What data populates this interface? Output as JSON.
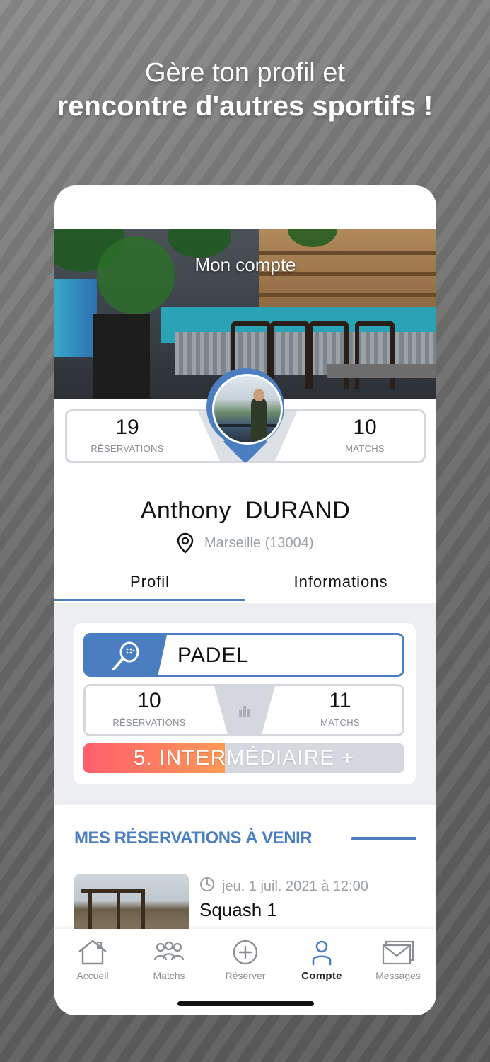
{
  "promo": {
    "line1": "Gère ton profil et",
    "line2": "rencontre d'autres sportifs !"
  },
  "header": {
    "title": "Mon compte"
  },
  "stats": {
    "reservations_count": "19",
    "reservations_label": "RÉSERVATIONS",
    "matches_count": "10",
    "matches_label": "MATCHS"
  },
  "profile": {
    "first_name": "Anthony",
    "last_name": "DURAND",
    "location": "Marseille (13004)"
  },
  "tabs": [
    {
      "label": "Profil",
      "active": true
    },
    {
      "label": "Informations",
      "active": false
    }
  ],
  "sport": {
    "name": "PADEL",
    "icon": "padel-racket-icon",
    "reservations_count": "10",
    "reservations_label": "RÉSERVATIONS",
    "matches_count": "11",
    "matches_label": "MATCHS",
    "level_label": "5. INTERMÉDIAIRE +",
    "level_progress": 0.44
  },
  "upcoming": {
    "title": "MES RÉSERVATIONS À VENIR",
    "items": [
      {
        "date": "jeu. 1 juil. 2021 à 12:00",
        "name": "Squash 1"
      }
    ]
  },
  "nav": [
    {
      "label": "Accueil",
      "icon": "home-icon",
      "active": false
    },
    {
      "label": "Matchs",
      "icon": "players-icon",
      "active": false
    },
    {
      "label": "Réserver",
      "icon": "plus-circle-icon",
      "active": false
    },
    {
      "label": "Compte",
      "icon": "user-icon",
      "active": true
    },
    {
      "label": "Messages",
      "icon": "mail-icon",
      "active": false
    }
  ],
  "colors": {
    "accent": "#4a7ec0",
    "level_gradient_start": "#ff5f6d",
    "level_gradient_end": "#ff9a55"
  }
}
